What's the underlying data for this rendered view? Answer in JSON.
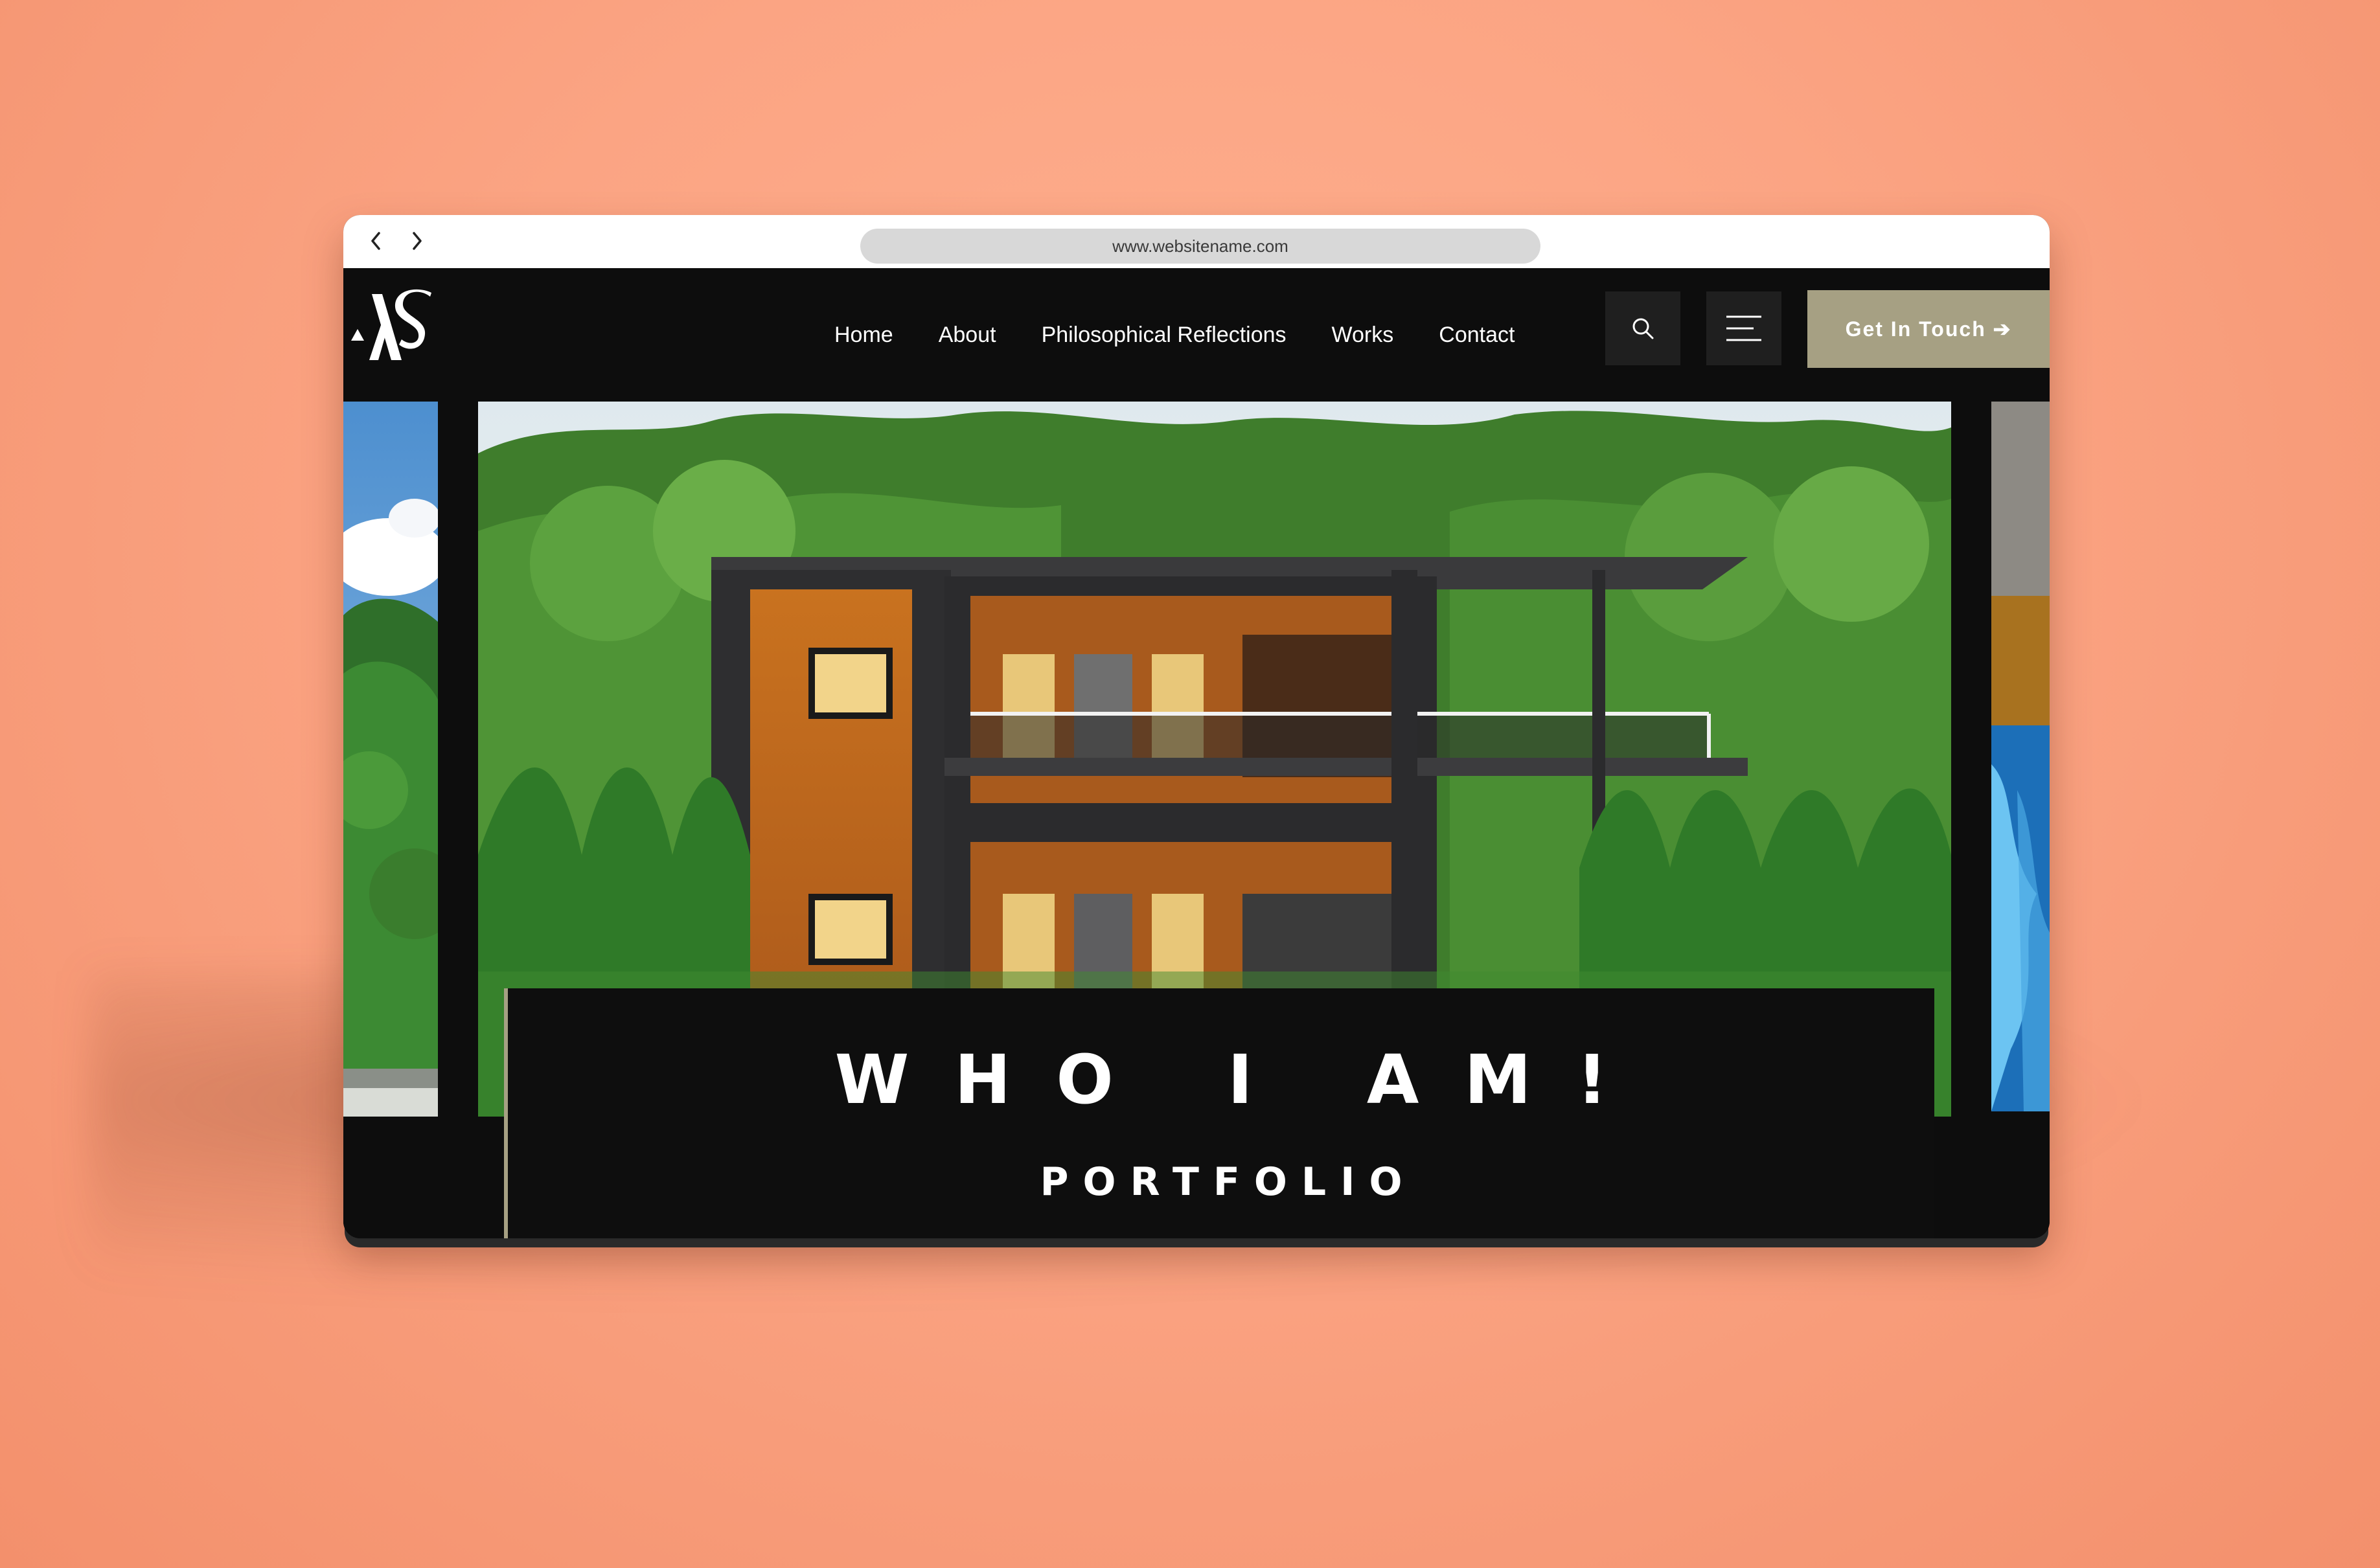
{
  "browser": {
    "url": "www.websitename.com",
    "back_icon": "chevron-left-icon",
    "forward_icon": "chevron-right-icon"
  },
  "header": {
    "logo_text": "AS",
    "nav": [
      {
        "label": "Home"
      },
      {
        "label": "About"
      },
      {
        "label": "Philosophical Reflections"
      },
      {
        "label": "Works"
      },
      {
        "label": "Contact"
      }
    ],
    "search_icon": "search-icon",
    "menu_icon": "hamburger-menu-icon",
    "cta_label": "Get In Touch ➔"
  },
  "hero": {
    "title": "WHO I AM!",
    "subtitle": "PORTFOLIO"
  },
  "colors": {
    "background": "#fba483",
    "site_bg": "#0d0d0d",
    "accent": "#a6a083",
    "url_bar": "#d8d8d8"
  }
}
